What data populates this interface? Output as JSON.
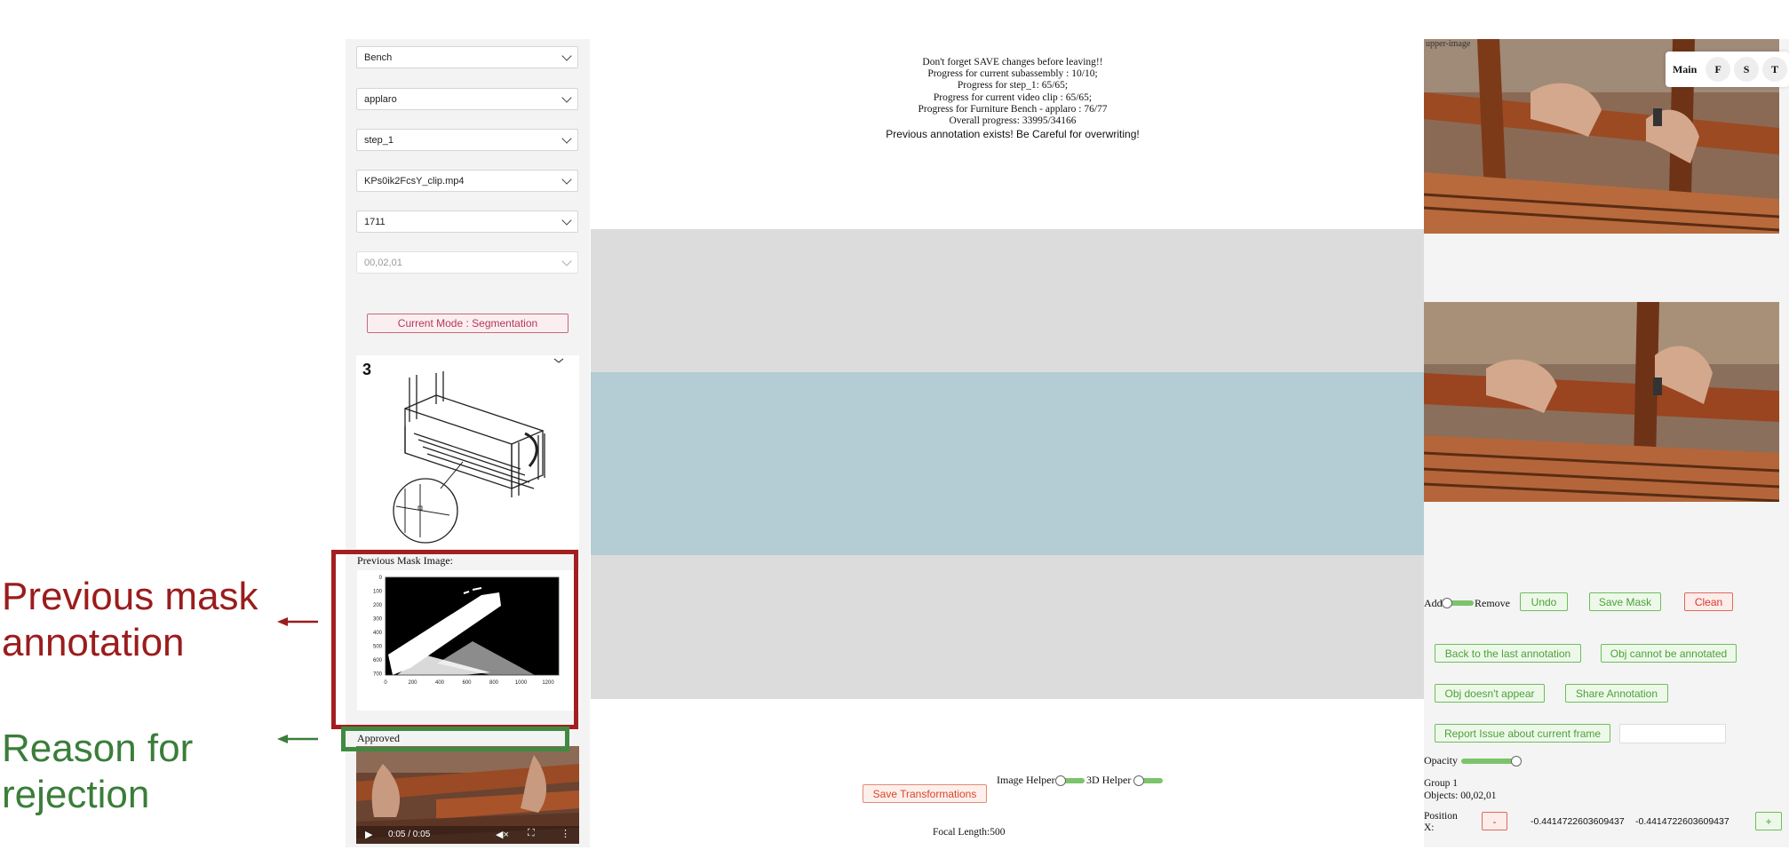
{
  "callouts": {
    "previous_mask_line1": "Previous mask",
    "previous_mask_line2": "annotation",
    "reason_line1": "Reason for",
    "reason_line2": "rejection"
  },
  "colors": {
    "callout_red": "#9b1c1c",
    "callout_green": "#3a7d3a",
    "accent_green": "#7cc46b",
    "danger_red": "#d53a2c"
  },
  "left_panel": {
    "selects": [
      "Bench",
      "applaro",
      "step_1",
      "KPs0ik2FcsY_clip.mp4",
      "1711",
      "00,02,01"
    ],
    "mode_button": "Current Mode : Segmentation",
    "manual": {
      "step_number": "3",
      "icon": "bench-assembly-diagram"
    },
    "previous_mask_label": "Previous Mask Image:",
    "mask_plot": {
      "y_ticks": [
        "0",
        "100",
        "200",
        "300",
        "400",
        "500",
        "600",
        "700"
      ],
      "x_ticks": [
        "0",
        "200",
        "400",
        "600",
        "800",
        "1000",
        "1200"
      ]
    },
    "status_text": "Approved",
    "video": {
      "time": "0:05 / 0:05",
      "icons": [
        "play-icon",
        "mute-icon",
        "fullscreen-icon",
        "more-icon"
      ]
    }
  },
  "center": {
    "info_lines": [
      "Don't forget SAVE changes before leaving!!",
      "Progress for current subassembly : 10/10;",
      "Progress for step_1: 65/65;",
      "Progress for current video clip : 65/65;",
      "Progress for Furniture Bench - applaro : 76/77",
      "Overall progress: 33995/34166"
    ],
    "warning": "Previous annotation exists! Be Careful for overwriting!",
    "save_transformations": "Save Transformations",
    "image_helper": "Image Helper",
    "helper_3d": "3D Helper",
    "focal_length": "Focal Length:500"
  },
  "right_panel": {
    "image_alt": "upper-image",
    "tabs": [
      "Main",
      "F",
      "S",
      "T"
    ],
    "add_label": "Add",
    "remove_label": "Remove",
    "undo": "Undo",
    "save_mask": "Save Mask",
    "clean": "Clean",
    "back_last": "Back to the last annotation",
    "obj_cannot": "Obj cannot be annotated",
    "obj_doesnt": "Obj doesn't appear",
    "share": "Share Annotation",
    "report": "Report Issue about current frame",
    "opacity": "Opacity",
    "group": "Group 1",
    "objects": "Objects: 00,02,01",
    "position_label_1": "Position",
    "position_label_2": "X:",
    "minus": "-",
    "plus": "+",
    "pos_value_1": "-0.4414722603609437",
    "pos_value_2": "-0.4414722603609437"
  }
}
